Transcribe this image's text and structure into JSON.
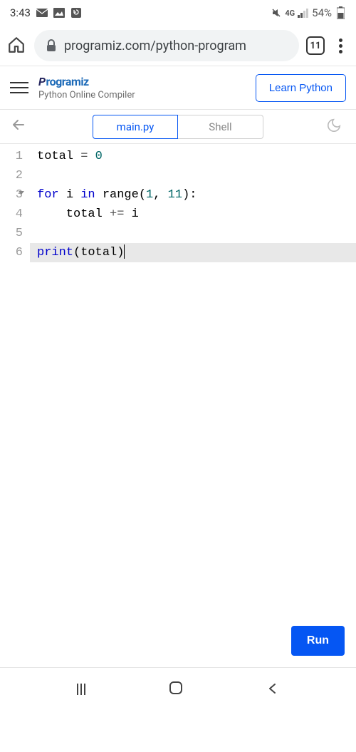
{
  "status": {
    "time": "3:43",
    "network_label": "4G",
    "battery_pct": "54%"
  },
  "browser": {
    "url": "programiz.com/python-program",
    "tab_count": "11"
  },
  "app": {
    "brand": "rogramiz",
    "subtitle": "Python Online Compiler",
    "learn_button": "Learn Python"
  },
  "tabs": {
    "main": "main.py",
    "shell": "Shell"
  },
  "editor": {
    "lines": [
      {
        "n": "1",
        "tokens": [
          {
            "t": "total ",
            "c": ""
          },
          {
            "t": "= ",
            "c": "op"
          },
          {
            "t": "0",
            "c": "num"
          }
        ]
      },
      {
        "n": "2",
        "tokens": []
      },
      {
        "n": "3",
        "fold": true,
        "tokens": [
          {
            "t": "for ",
            "c": "kw"
          },
          {
            "t": "i ",
            "c": ""
          },
          {
            "t": "in ",
            "c": "kw"
          },
          {
            "t": "range",
            "c": ""
          },
          {
            "t": "(",
            "c": ""
          },
          {
            "t": "1",
            "c": "num"
          },
          {
            "t": ", ",
            "c": ""
          },
          {
            "t": "11",
            "c": "num"
          },
          {
            "t": "):",
            "c": ""
          }
        ]
      },
      {
        "n": "4",
        "tokens": [
          {
            "t": "    total ",
            "c": ""
          },
          {
            "t": "+= ",
            "c": "op"
          },
          {
            "t": "i",
            "c": ""
          }
        ]
      },
      {
        "n": "5",
        "tokens": []
      },
      {
        "n": "6",
        "hl": true,
        "cursor": true,
        "tokens": [
          {
            "t": "print",
            "c": "fn"
          },
          {
            "t": "(total)",
            "c": ""
          }
        ]
      }
    ],
    "run_button": "Run"
  }
}
